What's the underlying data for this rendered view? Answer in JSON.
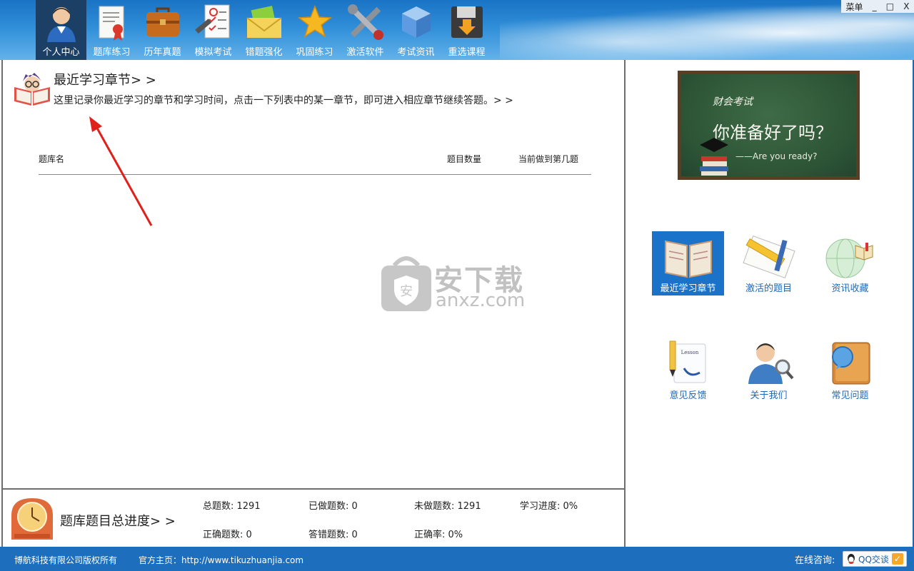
{
  "nav": {
    "items": [
      {
        "label": "个人中心",
        "icon": "user-avatar-icon",
        "active": true
      },
      {
        "label": "题库练习",
        "icon": "certificate-icon"
      },
      {
        "label": "历年真题",
        "icon": "briefcase-icon"
      },
      {
        "label": "模拟考试",
        "icon": "exam-paper-icon"
      },
      {
        "label": "错题强化",
        "icon": "envelope-icon"
      },
      {
        "label": "巩固练习",
        "icon": "star-icon"
      },
      {
        "label": "激活软件",
        "icon": "tools-icon"
      },
      {
        "label": "考试资讯",
        "icon": "cube-icon"
      },
      {
        "label": "重选课程",
        "icon": "save-disk-icon"
      }
    ]
  },
  "window": {
    "menu_label": "菜单",
    "minimize": "_",
    "maximize": "□",
    "close": "X"
  },
  "recent": {
    "title": "最近学习章节> >",
    "description": "这里记录你最近学习的章节和学习时间，点击一下列表中的某一章节，即可进入相应章节继续答题。> >",
    "columns": [
      "题库名",
      "题目数量",
      "当前做到第几题"
    ],
    "rows": []
  },
  "watermark": {
    "text": "安下载",
    "sub": "anxz.com"
  },
  "progress": {
    "title": "题库题目总进度> >",
    "stats": {
      "total": "总题数: 1291",
      "done": "已做题数: 0",
      "undone": "未做题数: 1291",
      "study_progress": "学习进度: 0%",
      "correct": "正确题数: 0",
      "wrong": "答错题数: 0",
      "accuracy": "正确率: 0%"
    }
  },
  "board": {
    "brand": "财会考试",
    "question": "你准备好了吗？",
    "sub": "——Are you ready?"
  },
  "shortcuts": [
    {
      "label": "最近学习章节",
      "icon": "open-book-icon",
      "active": true
    },
    {
      "label": "激活的题目",
      "icon": "ruler-pencil-icon"
    },
    {
      "label": "资讯收藏",
      "icon": "globe-book-icon"
    },
    {
      "label": "意见反馈",
      "icon": "pen-paper-icon"
    },
    {
      "label": "关于我们",
      "icon": "person-magnifier-icon"
    },
    {
      "label": "常见问题",
      "icon": "book-bubble-icon"
    }
  ],
  "footer": {
    "copyright": "博航科技有限公司版权所有",
    "site": "官方主页：http://www.tikuzhuanjia.com",
    "consult": "在线咨询:",
    "qq_button": "QQ交谈"
  },
  "colors": {
    "accent": "#1d6fbe",
    "active_nav": "#1c3f66",
    "shortcut_active": "#1b73c9",
    "arrow": "#e0201a"
  }
}
